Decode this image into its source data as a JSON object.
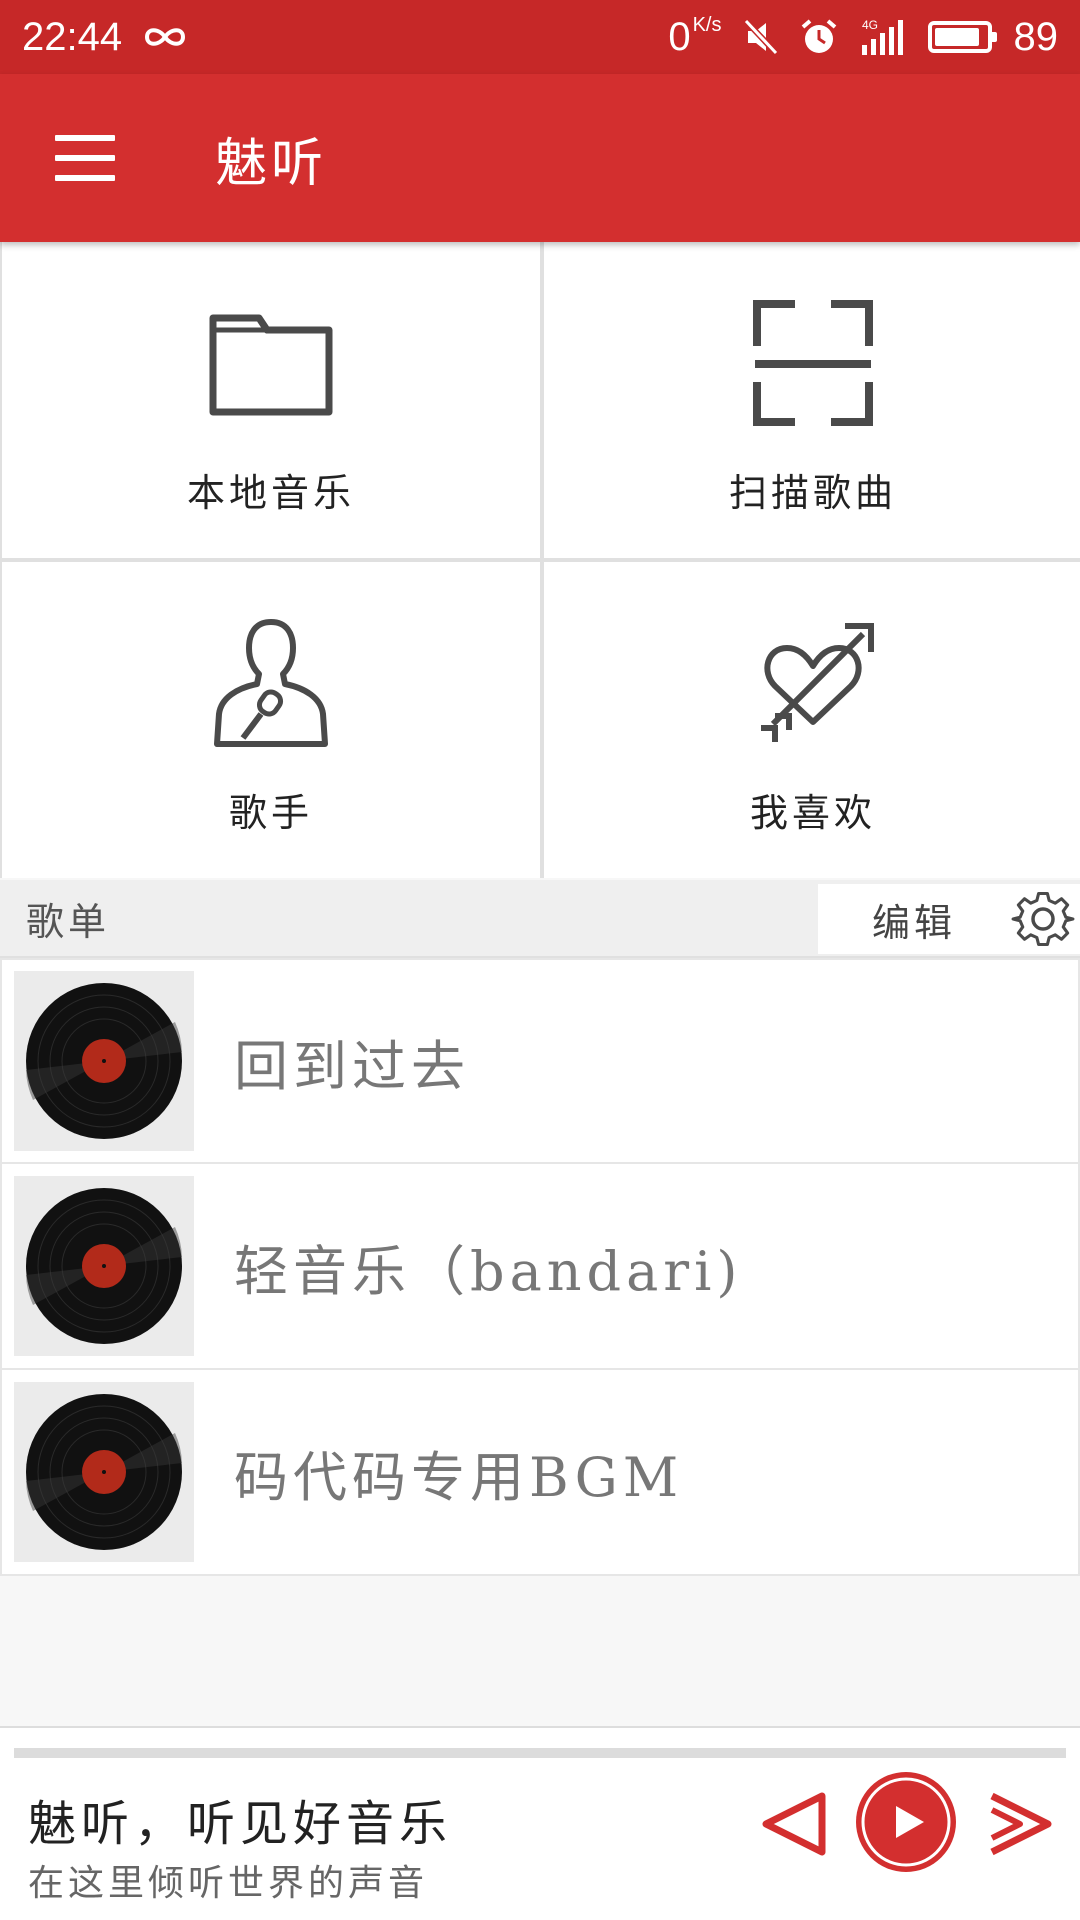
{
  "status_bar": {
    "time": "22:44",
    "net_speed_value": "0",
    "net_speed_unit": "K/s",
    "network": "4G",
    "battery": "89",
    "battery_level": 0.89,
    "icons": [
      "infinity-icon",
      "mute-icon",
      "alarm-icon",
      "signal-icon",
      "battery-icon"
    ]
  },
  "app_bar": {
    "title": "魅听"
  },
  "grid": {
    "tiles": [
      {
        "label": "本地音乐",
        "icon": "folder-icon"
      },
      {
        "label": "扫描歌曲",
        "icon": "scan-icon"
      },
      {
        "label": "歌手",
        "icon": "singer-icon"
      },
      {
        "label": "我喜欢",
        "icon": "heart-arrow-icon"
      }
    ]
  },
  "playlists": {
    "header": "歌单",
    "edit_label": "编辑",
    "items": [
      {
        "name": "回到过去"
      },
      {
        "name": "轻音乐（bandari)"
      },
      {
        "name": "码代码专用BGM"
      }
    ]
  },
  "player": {
    "title": "魅听，听见好音乐",
    "subtitle": "在这里倾听世界的声音",
    "progress": 0,
    "accent": "#c62828"
  },
  "colors": {
    "status_bar": "#c62828",
    "app_bar": "#d32f2f",
    "icon": "#4a4a4a"
  }
}
